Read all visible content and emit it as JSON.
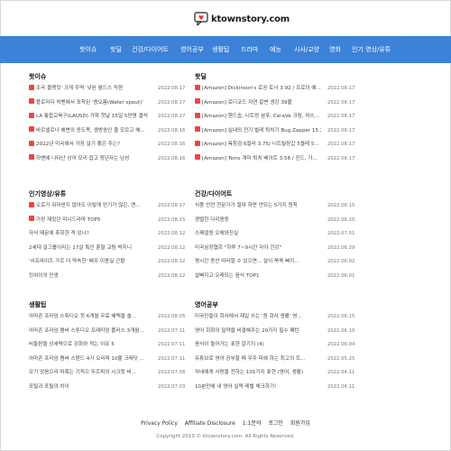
{
  "site": {
    "logo_text": "ktownstory.com"
  },
  "nav": [
    "핫이슈",
    "핫딜",
    "건강/다이어트",
    "영어공부",
    "생활팁",
    "드라마",
    "예능",
    "시사/교양",
    "영화",
    "인기 영상/유튜"
  ],
  "sections": [
    {
      "title": "핫이슈",
      "items": [
        {
          "text": "조국 블랭킷' 크게 주역' 낮된 월드스 직원",
          "date": "2022.08.17",
          "hot": true
        },
        {
          "text": "플로리다 허벤에서 포착된 '용오름(Water spout)'",
          "date": "2022.08.17",
          "hot": true
        },
        {
          "text": "LA 통합교육구(LAUSD) 가학 첫날 15일 5만명 결석",
          "date": "2022.08.17",
          "hot": true
        },
        {
          "text": "바르셀로나 해변의 동도목, 생방송인 줄 모르고 해...",
          "date": "2022.08.16",
          "hot": true
        },
        {
          "text": "2022년 미국에서 가장 살기 좋은 주는?",
          "date": "2022.08.16",
          "hot": true
        },
        {
          "text": "하벤에 나타난 상어 모리 잡고 청년자는 남성",
          "date": "2022.08.16",
          "hot": true
        }
      ]
    },
    {
      "title": "핫딜",
      "items": [
        {
          "text": "[Amazon] Dickinson's 로공 토너 3.92 / 프로이 예...",
          "date": "2022.08.17",
          "hot": true
        },
        {
          "text": "[Amazon] 로디코드 자연 갈변 생강 39불",
          "date": "2022.08.17",
          "hot": true
        },
        {
          "text": "[Amazon] 핸드솝, 니트렁 삼푸, CeraVe 크림, 마스...",
          "date": "2022.08.17",
          "hot": true
        },
        {
          "text": "[Amazon] 실내외 전기 벌레 퇴치기 Bug Zapper 15.20",
          "date": "2022.08.17",
          "hot": true
        },
        {
          "text": "[Amazon] 욕창검 6컬러 3.75/ 니트릴장갑 5켤레 5...",
          "date": "2022.08.17",
          "hot": true
        },
        {
          "text": "[Amazon] Terro 개미 퇴치 베이트 3.58 / 진드, 가...",
          "date": "2022.08.17",
          "hot": true
        }
      ]
    },
    {
      "title": "인기영상/유튜",
      "items": [
        {
          "text": "오로가 뒤어낸지 않아도 이렇게 만기가 많은, 엔...",
          "date": "2022.08.17",
          "hot": true
        },
        {
          "text": "가장 재밌던 미니드라마 TOP5",
          "date": "2022.08.15",
          "hot": true
        },
        {
          "text": "자식 때문에 후회한 적 있나?",
          "date": "2022.08.12",
          "hot": false
        },
        {
          "text": "2세대 걸그룹이라는 17살 톡인 훈팔 교팀 박지니",
          "date": "2022.08.12",
          "hot": false
        },
        {
          "text": "'서프라이즈 가르 더 약속한' 배우 이종실 근황",
          "date": "2022.08.12",
          "hot": false
        },
        {
          "text": "킹위이의 인생",
          "date": "2022.08.12",
          "hot": false
        }
      ]
    },
    {
      "title": "건강/다이어트",
      "items": [
        {
          "text": "식품 안전 전문가가 절대 하면 안되는 5가지 원칙",
          "date": "2022.06.15",
          "hot": false
        },
        {
          "text": "경렬한 다리용동",
          "date": "2022.06.10",
          "hot": false
        },
        {
          "text": "스페셜링 오해와진실",
          "date": "2022.07.01",
          "hot": false
        },
        {
          "text": "미국심장협회 \"하루 7~9시간 자야 건강\"",
          "date": "2022.06.29",
          "hot": false
        },
        {
          "text": "평시간 동안 따라할 수 있으면... 살이 쭉쭉 빠지...",
          "date": "2022.06.02",
          "hot": false
        },
        {
          "text": "살빠지고 오래되는 음식 TOP1",
          "date": "2022.06.01",
          "hot": false
        }
      ]
    },
    {
      "title": "생활팁",
      "items": [
        {
          "text": "아마존 프라임 스튜디오 첫 6개월 무료 혜택을 솔...",
          "date": "2022.08.05",
          "hot": false
        },
        {
          "text": "아마존 프라임 멤버 스튜디오 프레미엄 플러스 3개월...",
          "date": "2022.07.11",
          "hot": false
        },
        {
          "text": "비들판을 상세략으로 강화와 적는 이유 5",
          "date": "2022.07.11",
          "hot": false
        },
        {
          "text": "아마존 프라임 멤버 스탠드 4가 오리며 10불 크레딧 ...",
          "date": "2022.07.11",
          "hot": false
        },
        {
          "text": "모기 앉음으리 따혹는 기적으 뚜르피의 시크릿 비...",
          "date": "2022.07.08",
          "hot": false
        },
        {
          "text": "포틸과 포틸의 차이",
          "date": "2022.07.03",
          "hot": false
        }
      ]
    },
    {
      "title": "영어공부",
      "items": [
        {
          "text": "미국인들이 회사에서 제일 쓰는 '원 회사 생활' 영...",
          "date": "2022.06.15",
          "hot": false
        },
        {
          "text": "영어 회화의 밀약을 비결해주는 20가지 필수 패턴",
          "date": "2022.06.10",
          "hot": false
        },
        {
          "text": "음식이 들어가는 표현 알기지 (4)",
          "date": "2022.06.04",
          "hot": false
        },
        {
          "text": "유튜브로 영어 공부할 때 우주 피에 하는 최고의 트...",
          "date": "2022.05.25",
          "hot": false
        },
        {
          "text": "자네에게 사랑을 전하는 101가지 표현 (영어, 생활)",
          "date": "2022.04.11",
          "hot": false
        },
        {
          "text": "10분만에 내 영어 실력 레벨 체크하기!",
          "date": "2022.04.11",
          "hot": false
        }
      ]
    }
  ],
  "footer": {
    "links": [
      "Privacy Policy",
      "Affiliate Disclosure",
      "1:1문의",
      "로그인",
      "회원가입"
    ],
    "copyright": "Copyright 2010 © ktownstory.com. All Rights Reserved."
  }
}
